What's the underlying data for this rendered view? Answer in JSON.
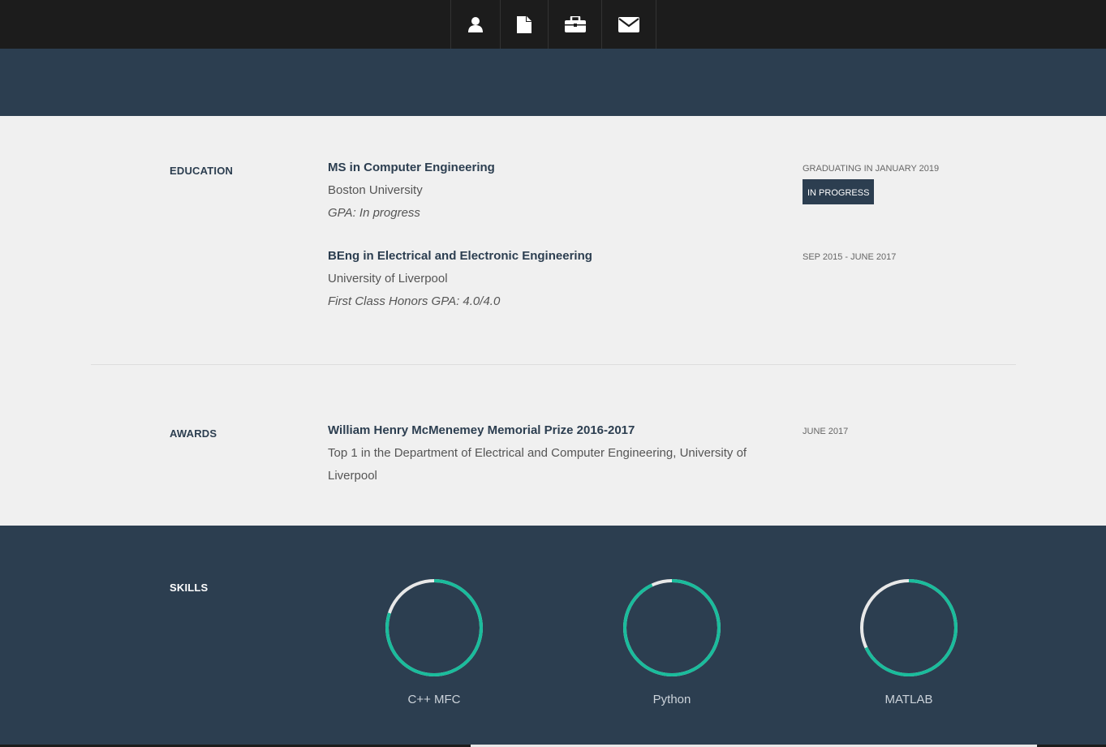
{
  "nav": {
    "items": [
      {
        "icon": "user-icon"
      },
      {
        "icon": "file-icon"
      },
      {
        "icon": "briefcase-icon"
      },
      {
        "icon": "envelope-icon"
      }
    ]
  },
  "education": {
    "label": "EDUCATION",
    "items": [
      {
        "title": "MS in Computer Engineering",
        "school": "Boston University",
        "note": "GPA: In progress",
        "date": "GRADUATING IN JANUARY 2019",
        "badge": "IN PROGRESS"
      },
      {
        "title": "BEng in Electrical and Electronic Engineering",
        "school": "University of Liverpool",
        "note": "First Class Honors GPA: 4.0/4.0",
        "date": "SEP 2015 - JUNE 2017"
      }
    ]
  },
  "awards": {
    "label": "AWARDS",
    "items": [
      {
        "title": "William Henry McMenemey Memorial Prize 2016-2017",
        "desc": "Top 1 in the Department of Electrical and Computer Engineering, University of Liverpool",
        "date": "JUNE 2017"
      }
    ]
  },
  "skills": {
    "label": "SKILLS",
    "items": [
      {
        "name": "C++ MFC",
        "level": 0.8
      },
      {
        "name": "Python",
        "level": 0.93
      },
      {
        "name": "MATLAB",
        "level": 0.68
      }
    ]
  },
  "colors": {
    "dark": "#2c3e50",
    "nav": "#1c1c1c",
    "accent": "#1abc9c",
    "ring_track": "#e8e8e8"
  }
}
